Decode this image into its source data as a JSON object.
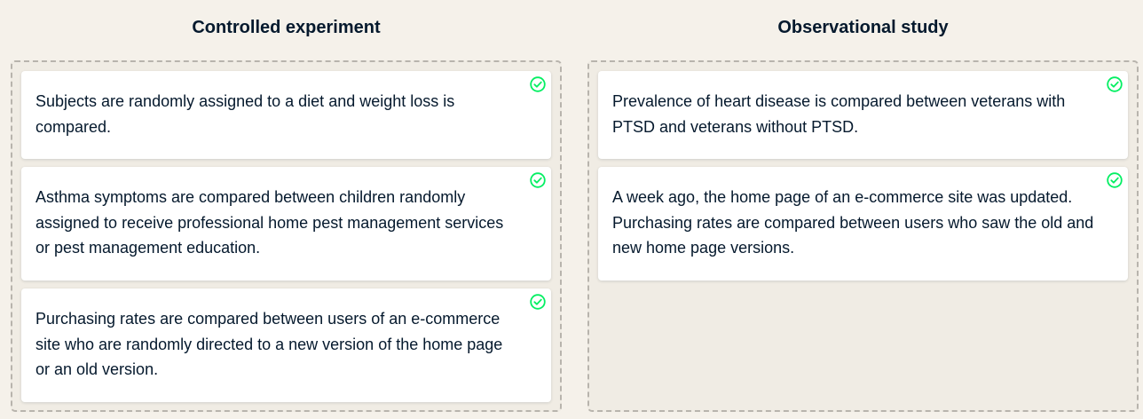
{
  "columns": {
    "controlled": {
      "title": "Controlled experiment",
      "items": [
        {
          "text": "Subjects are randomly assigned to a diet and weight loss is compared.",
          "status": "correct"
        },
        {
          "text": "Asthma symptoms are compared between children randomly assigned to receive professional home pest management services or pest management education.",
          "status": "correct"
        },
        {
          "text": "Purchasing rates are compared between users of an e-commerce site who are randomly directed to a new version of the home page or an old version.",
          "status": "correct"
        }
      ]
    },
    "observational": {
      "title": "Observational study",
      "items": [
        {
          "text": "Prevalence of heart disease is compared between veterans with PTSD and veterans without PTSD.",
          "status": "correct"
        },
        {
          "text": "A week ago, the home page of an e-commerce site was updated. Purchasing rates are compared between users who saw the old and new home page versions.",
          "status": "correct"
        }
      ]
    }
  },
  "icons": {
    "status_icon": "check-circle-icon"
  },
  "colors": {
    "background": "#f5f1ea",
    "card": "#ffffff",
    "text": "#05192d",
    "success": "#03ef62"
  }
}
